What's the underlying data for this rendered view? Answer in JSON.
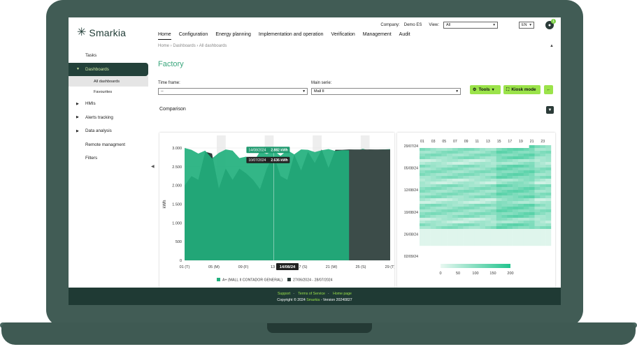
{
  "header": {
    "brand": "Smarkia",
    "company_label": "Company:",
    "company_value": "Demo ES",
    "view_label": "View:",
    "view_value": "All",
    "language": "EN",
    "notification_count": "1"
  },
  "nav": {
    "items": [
      "Home",
      "Configuration",
      "Energy planning",
      "Implementation and operation",
      "Verification",
      "Management",
      "Audit"
    ]
  },
  "breadcrumb": [
    "Home",
    "Dashboards",
    "All dashboards"
  ],
  "sidebar": {
    "items": [
      {
        "label": "Tasks"
      },
      {
        "label": "Dashboards"
      },
      {
        "label": "All dashboards"
      },
      {
        "label": "Favourites"
      },
      {
        "label": "HMIs"
      },
      {
        "label": "Alerts tracking"
      },
      {
        "label": "Data analysis"
      },
      {
        "label": "Remote managment"
      },
      {
        "label": "Filters"
      }
    ]
  },
  "page": {
    "title": "Factory",
    "time_frame_label": "Time frame:",
    "time_frame_value": "--",
    "main_serie_label": "Main serie:",
    "main_serie_value": "Mall II",
    "tools_label": "Tools",
    "kiosk_label": "Kiosk mode",
    "section_title": "Comparison"
  },
  "chart_data": [
    {
      "type": "area",
      "ylabel": "kWh",
      "ylim": [
        0,
        3000
      ],
      "yticks": [
        "3.000",
        "2.500",
        "2.000",
        "1.500",
        "1.000",
        "500",
        "0"
      ],
      "xticks": [
        "01 (T)",
        "05 (M)",
        "09 (F)",
        "13",
        "17 (S)",
        "21 (W)",
        "25 (S)",
        "29 (T)"
      ],
      "x_highlight": "14/08/24",
      "tooltips": [
        {
          "date": "14/08/2024",
          "value": "2.882 kWh"
        },
        {
          "date": "10/07/2024",
          "value": "2.636 kWh"
        }
      ],
      "series": [
        {
          "name": "A+ (MALL II CONTADOR GENERAL)",
          "color": "#22b07d",
          "values": [
            3000,
            2950,
            2850,
            2930,
            2720,
            2870,
            2960,
            2930,
            2730,
            2770,
            2600,
            2910,
            2840,
            2930,
            2790,
            2940,
            2830,
            2960,
            2950,
            2890,
            2940,
            2970,
            2920,
            2940,
            2940,
            2920,
            2980,
            2930,
            2950,
            2960,
            2970
          ]
        },
        {
          "name": "27/06/2024 - 28/07/2024",
          "color": "#2c3b38",
          "values": [
            2000,
            2250,
            2150,
            2900,
            2850,
            1920,
            2450,
            2150,
            2450,
            2320,
            2150,
            1900,
            2450,
            2820,
            2250,
            2150,
            2820,
            2400,
            2900,
            2600,
            2960,
            2470,
            2950,
            2950,
            2960,
            2950,
            2930,
            2960,
            2950,
            2960,
            2950
          ]
        }
      ]
    },
    {
      "type": "heatmap",
      "x": [
        "01",
        "03",
        "05",
        "07",
        "09",
        "11",
        "13",
        "15",
        "17",
        "19",
        "21",
        "23"
      ],
      "y": [
        "29/07/24",
        "05/08/24",
        "12/08/24",
        "19/08/24",
        "26/08/24",
        "02/09/24"
      ],
      "color_scale": [
        "#e9f8f1",
        "#22c48e"
      ],
      "scale_ticks": [
        "0",
        "50",
        "100",
        "150",
        "200"
      ]
    }
  ],
  "footer": {
    "links": [
      "Support",
      "Terms of Service",
      "Home page"
    ],
    "copyright": "Copyright © 2024",
    "brand": "Smarkia",
    "version": "- Version 20240827"
  }
}
